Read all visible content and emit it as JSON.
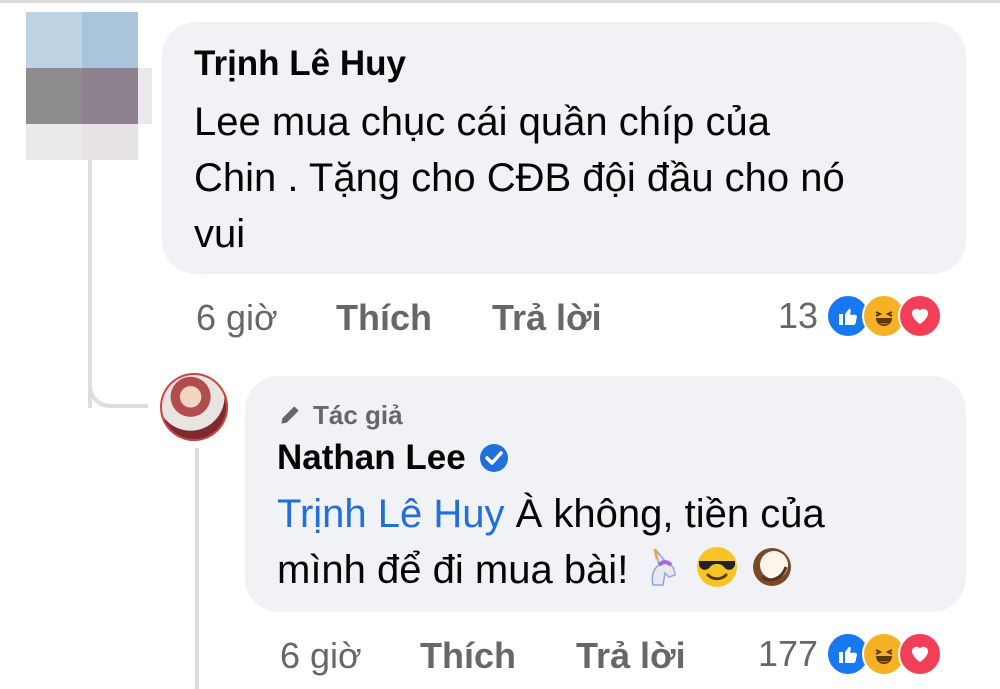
{
  "comment1": {
    "author": "Trịnh Lê Huy",
    "text_lines": [
      "Lee mua chục cái quần chíp của",
      "Chin . Tặng cho CĐB đội đầu cho nó",
      "vui"
    ],
    "time": "6 giờ",
    "like_label": "Thích",
    "reply_label": "Trả lời",
    "reaction_count": "13",
    "reactions": [
      "like-icon",
      "haha-icon",
      "love-icon"
    ]
  },
  "comment2": {
    "badge": "Tác giả",
    "author": "Nathan Lee",
    "mention": "Trịnh Lê Huy",
    "text_line1": " À không, tiền của",
    "text_line2": "mình để đi mua bài!",
    "emojis": [
      "unicorn-emoji",
      "sunglasses-emoji",
      "coconut-emoji"
    ],
    "time": "6 giờ",
    "like_label": "Thích",
    "reply_label": "Trả lời",
    "reaction_count": "177",
    "reactions": [
      "like-icon",
      "haha-icon",
      "love-icon"
    ]
  },
  "colors": {
    "bubble": "#f0f2f5",
    "mention": "#216fdb",
    "meta_text": "#65676b",
    "like": "#1877f2",
    "haha": "#f7b125",
    "love": "#f33e58"
  }
}
